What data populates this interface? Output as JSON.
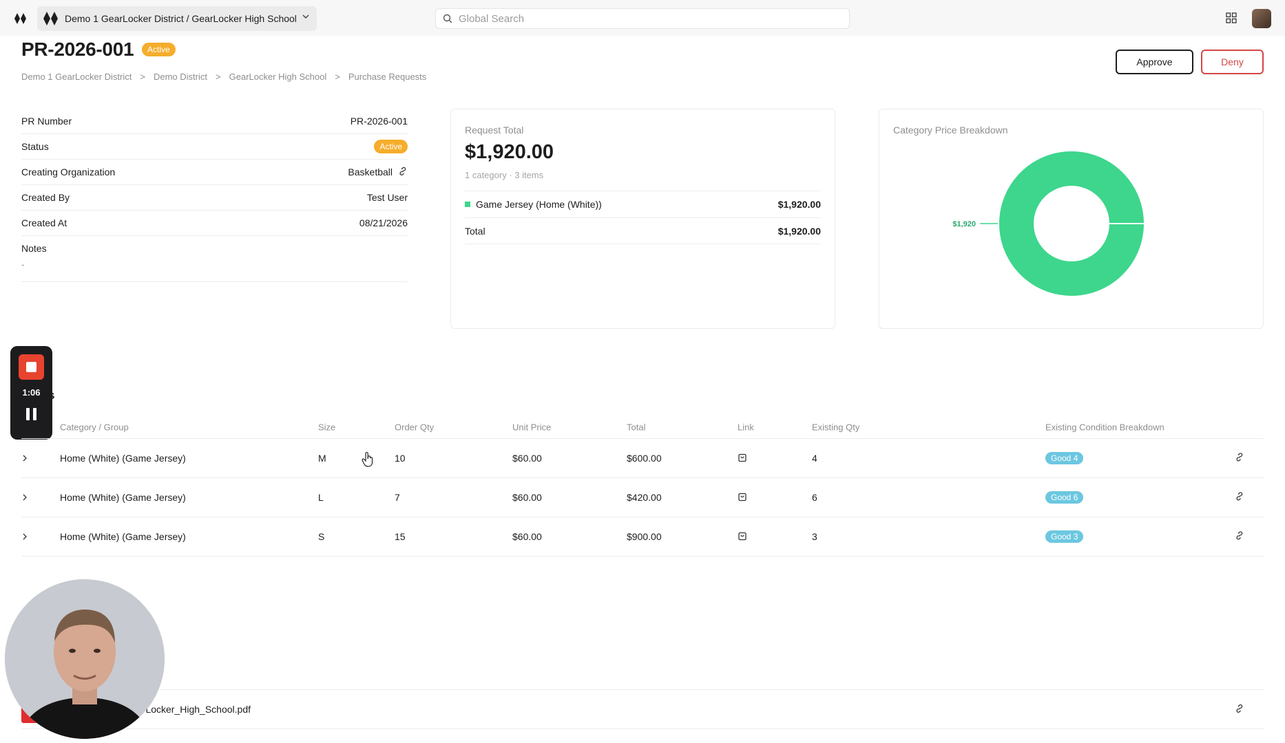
{
  "topbar": {
    "org_label": "Demo 1 GearLocker District / GearLocker High School",
    "search_placeholder": "Global Search"
  },
  "page": {
    "title": "PR-2026-001",
    "status_badge": "Active",
    "breadcrumb": [
      "Demo 1 GearLocker District",
      "Demo District",
      "GearLocker High School",
      "Purchase Requests"
    ],
    "breadcrumb_sep": ">",
    "approve_label": "Approve",
    "deny_label": "Deny"
  },
  "details": {
    "pr_number_label": "PR Number",
    "pr_number": "PR-2026-001",
    "status_label": "Status",
    "status": "Active",
    "org_label": "Creating Organization",
    "org": "Basketball",
    "created_by_label": "Created By",
    "created_by": "Test User",
    "created_at_label": "Created At",
    "created_at": "08/21/2026",
    "notes_label": "Notes",
    "notes": "-"
  },
  "request_total": {
    "label": "Request Total",
    "amount": "$1,920.00",
    "summary": "1 category · 3 items",
    "rows": [
      {
        "name": "Game Jersey (Home (White))",
        "amount": "$1,920.00"
      },
      {
        "name": "Total",
        "amount": "$1,920.00"
      }
    ],
    "swatch_color": "#3dd68c"
  },
  "chart_data": {
    "type": "pie",
    "title": "Category Price Breakdown",
    "categories": [
      "Game Jersey (Home (White))"
    ],
    "values": [
      1920
    ],
    "data_labels": [
      "$1,920"
    ],
    "colors": [
      "#3dd68c"
    ],
    "donut": true
  },
  "recorder": {
    "time": "1:06"
  },
  "items": {
    "section_fragment": "s",
    "headers": [
      "Category / Group",
      "Size",
      "Order Qty",
      "Unit Price",
      "Total",
      "Link",
      "Existing Qty",
      "Existing Condition Breakdown"
    ],
    "rows": [
      {
        "category": "Home (White) (Game Jersey)",
        "size": "M",
        "qty": "10",
        "unit": "$60.00",
        "total": "$600.00",
        "existing": "4",
        "condition": "Good 4"
      },
      {
        "category": "Home (White) (Game Jersey)",
        "size": "L",
        "qty": "7",
        "unit": "$60.00",
        "total": "$420.00",
        "existing": "6",
        "condition": "Good 6"
      },
      {
        "category": "Home (White) (Game Jersey)",
        "size": "S",
        "qty": "15",
        "unit": "$60.00",
        "total": "$900.00",
        "existing": "3",
        "condition": "Good 3"
      }
    ]
  },
  "document": {
    "filename": "arLocker_High_School.pdf"
  },
  "colors": {
    "accent_green": "#3dd68c",
    "active_orange": "#f5ad2b",
    "deny_red": "#d64545",
    "good_blue": "#6cc7e0"
  }
}
